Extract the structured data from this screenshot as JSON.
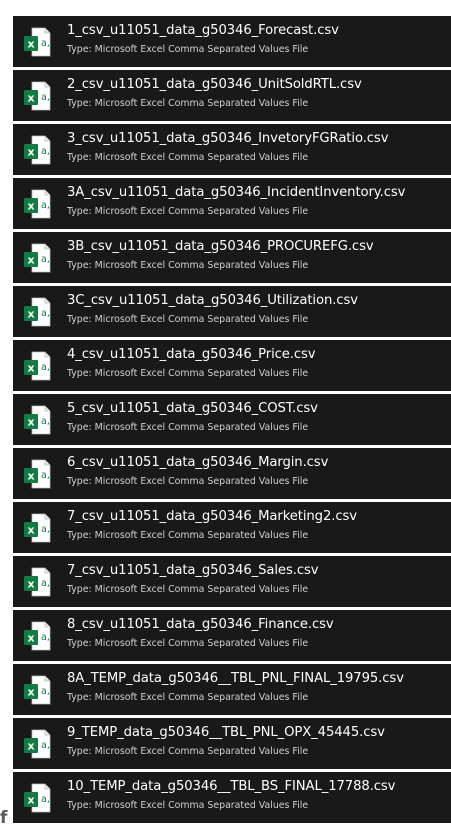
{
  "files": [
    {
      "name": "1_csv_u11051_data_g50346_Forecast.csv",
      "type": "Type: Microsoft Excel Comma Separated Values File",
      "icon": "excel-csv-icon"
    },
    {
      "name": "2_csv_u11051_data_g50346_UnitSoldRTL.csv",
      "type": "Type: Microsoft Excel Comma Separated Values File",
      "icon": "excel-csv-icon"
    },
    {
      "name": "3_csv_u11051_data_g50346_InvetoryFGRatio.csv",
      "type": "Type: Microsoft Excel Comma Separated Values File",
      "icon": "excel-csv-icon"
    },
    {
      "name": "3A_csv_u11051_data_g50346_IncidentInventory.csv",
      "type": "Type: Microsoft Excel Comma Separated Values File",
      "icon": "excel-csv-icon"
    },
    {
      "name": "3B_csv_u11051_data_g50346_PROCUREFG.csv",
      "type": "Type: Microsoft Excel Comma Separated Values File",
      "icon": "excel-csv-icon"
    },
    {
      "name": "3C_csv_u11051_data_g50346_Utilization.csv",
      "type": "Type: Microsoft Excel Comma Separated Values File",
      "icon": "excel-csv-icon"
    },
    {
      "name": "4_csv_u11051_data_g50346_Price.csv",
      "type": "Type: Microsoft Excel Comma Separated Values File",
      "icon": "excel-csv-icon"
    },
    {
      "name": "5_csv_u11051_data_g50346_COST.csv",
      "type": "Type: Microsoft Excel Comma Separated Values File",
      "icon": "excel-csv-icon"
    },
    {
      "name": "6_csv_u11051_data_g50346_Margin.csv",
      "type": "Type: Microsoft Excel Comma Separated Values File",
      "icon": "excel-csv-icon"
    },
    {
      "name": "7_csv_u11051_data_g50346_Marketing2.csv",
      "type": "Type: Microsoft Excel Comma Separated Values File",
      "icon": "excel-csv-icon"
    },
    {
      "name": "7_csv_u11051_data_g50346_Sales.csv",
      "type": "Type: Microsoft Excel Comma Separated Values File",
      "icon": "excel-csv-icon"
    },
    {
      "name": "8_csv_u11051_data_g50346_Finance.csv",
      "type": "Type: Microsoft Excel Comma Separated Values File",
      "icon": "excel-csv-icon"
    },
    {
      "name": "8A_TEMP_data_g50346__TBL_PNL_FINAL_19795.csv",
      "type": "Type: Microsoft Excel Comma Separated Values File",
      "icon": "excel-csv-icon"
    },
    {
      "name": "9_TEMP_data_g50346__TBL_PNL_OPX_45445.csv",
      "type": "Type: Microsoft Excel Comma Separated Values File",
      "icon": "excel-csv-icon"
    },
    {
      "name": "10_TEMP_data_g50346__TBL_BS_FINAL_17788.csv",
      "type": "Type: Microsoft Excel Comma Separated Values File",
      "icon": "excel-csv-icon"
    }
  ],
  "icon_letters": {
    "x": "x",
    "a": "a,"
  },
  "stray_text": "f",
  "colors": {
    "row_background": "#191919",
    "page_background": "#ffffff",
    "excel_green": "#107c41",
    "excel_dark_green": "#0b5a2e",
    "name_text": "#ffffff",
    "type_text": "#d0d0d0"
  }
}
